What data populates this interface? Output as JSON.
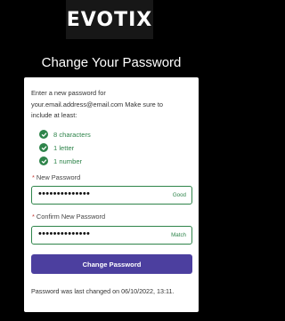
{
  "logo": {
    "text": "EVOTIX"
  },
  "title": "Change Your Password",
  "card": {
    "intro_line1": "Enter a new password for",
    "intro_line2": "your.email.address@email.com  Make sure to",
    "intro_line3": "include at least:",
    "requirements": [
      {
        "label": "8 characters",
        "met": true
      },
      {
        "label": "1 letter",
        "met": true
      },
      {
        "label": "1 number",
        "met": true
      }
    ],
    "new_password": {
      "label": "New Password",
      "required_marker": "*",
      "value": "••••••••••••••",
      "status": "Good"
    },
    "confirm_password": {
      "label": "Confirm New Password",
      "required_marker": "*",
      "value": "••••••••••••••",
      "status": "Match"
    },
    "submit_label": "Change Password",
    "footer": "Password was last changed on 06/10/2022, 13:11."
  },
  "colors": {
    "background": "#000000",
    "card": "#ffffff",
    "success": "#2e844a",
    "button": "#4c3f9f",
    "required": "#c23934"
  }
}
